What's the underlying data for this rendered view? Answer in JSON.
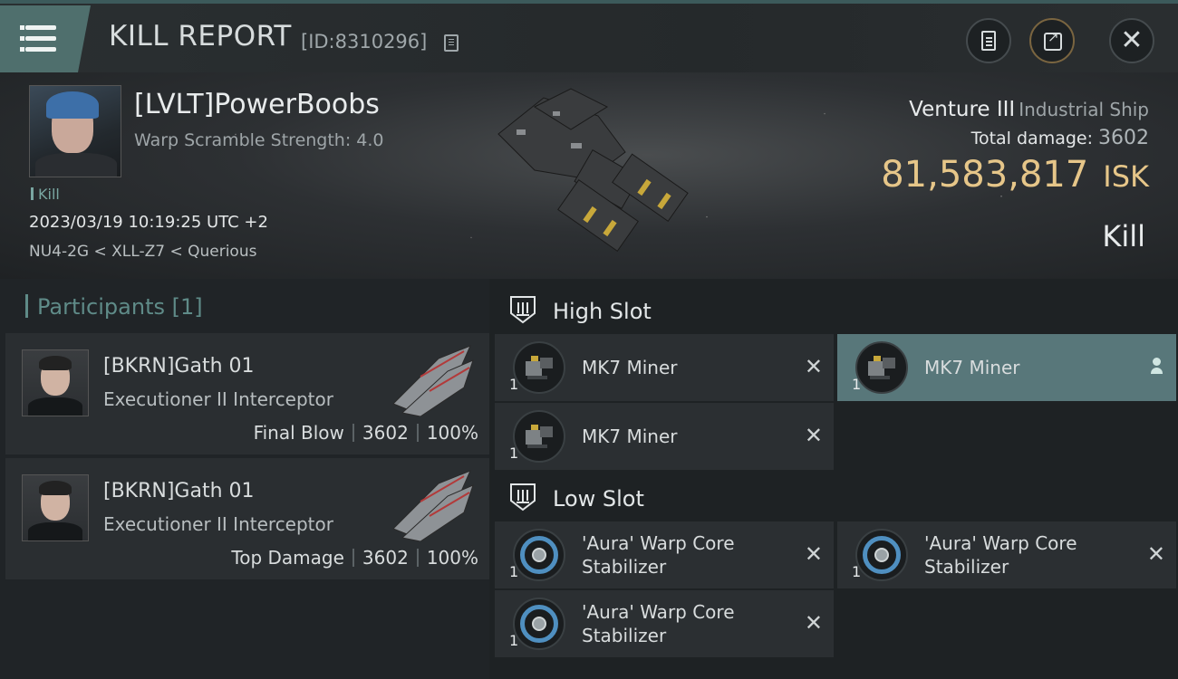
{
  "header": {
    "title": "KILL REPORT",
    "report_id": "[ID:8310296]"
  },
  "victim": {
    "name": "[LVLT]PowerBoobs",
    "scramble": "Warp Scramble Strength: 4.0",
    "tag": "Kill",
    "datetime": "2023/03/19 10:19:25 UTC +2",
    "location": "NU4-2G < XLL-Z7 < Querious",
    "ship_name": "Venture III",
    "ship_class": "Industrial Ship",
    "total_damage_label": "Total damage:",
    "total_damage": "3602",
    "isk_value": "81,583,817",
    "isk_unit": "ISK",
    "result": "Kill"
  },
  "participants": {
    "title": "Participants",
    "count": "[1]",
    "items": [
      {
        "name": "[BKRN]Gath 01",
        "ship": "Executioner II Interceptor",
        "role": "Final Blow",
        "damage": "3602",
        "percent": "100%"
      },
      {
        "name": "[BKRN]Gath 01",
        "ship": "Executioner II Interceptor",
        "role": "Top Damage",
        "damage": "3602",
        "percent": "100%"
      }
    ]
  },
  "fitting": {
    "high_slot": {
      "label": "High Slot",
      "modules": [
        {
          "qty": "1",
          "name": "MK7 Miner"
        },
        {
          "qty": "1",
          "name": "MK7 Miner"
        },
        {
          "qty": "1",
          "name": "MK7 Miner"
        }
      ]
    },
    "low_slot": {
      "label": "Low Slot",
      "modules": [
        {
          "qty": "1",
          "name": "'Aura' Warp Core Stabilizer"
        },
        {
          "qty": "1",
          "name": "'Aura' Warp Core Stabilizer"
        },
        {
          "qty": "1",
          "name": "'Aura' Warp Core Stabilizer"
        }
      ]
    }
  },
  "colors": {
    "accent": "#58777a",
    "isk": "#e6c689",
    "participants_title": "#5f8b88"
  }
}
